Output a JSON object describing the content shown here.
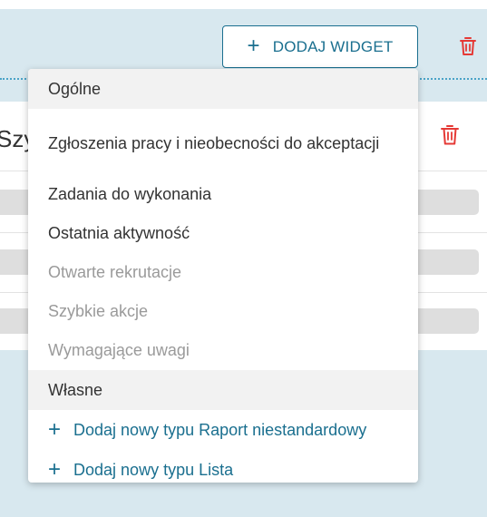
{
  "toolbar": {
    "add_widget_label": "DODAJ WIDGET"
  },
  "card": {
    "title": "Szy"
  },
  "dropdown": {
    "general_header": "Ogólne",
    "general_items": [
      {
        "label": "Zgłoszenia pracy i nieobecności do akceptacji",
        "enabled": true
      },
      {
        "label": "Zadania do wykonania",
        "enabled": true
      },
      {
        "label": "Ostatnia aktywność",
        "enabled": true
      },
      {
        "label": "Otwarte rekrutacje",
        "enabled": false
      },
      {
        "label": "Szybkie akcje",
        "enabled": false
      },
      {
        "label": "Wymagające uwagi",
        "enabled": false
      }
    ],
    "custom_header": "Własne",
    "custom_items": [
      {
        "label": "Dodaj nowy typu Raport niestandardowy"
      },
      {
        "label": "Dodaj nowy typu Lista"
      }
    ]
  },
  "colors": {
    "accent": "#1a6f8f",
    "danger": "#e53935",
    "background": "#d8e8ef"
  },
  "icons": {
    "plus": "plus-icon",
    "trash": "trash-icon"
  }
}
